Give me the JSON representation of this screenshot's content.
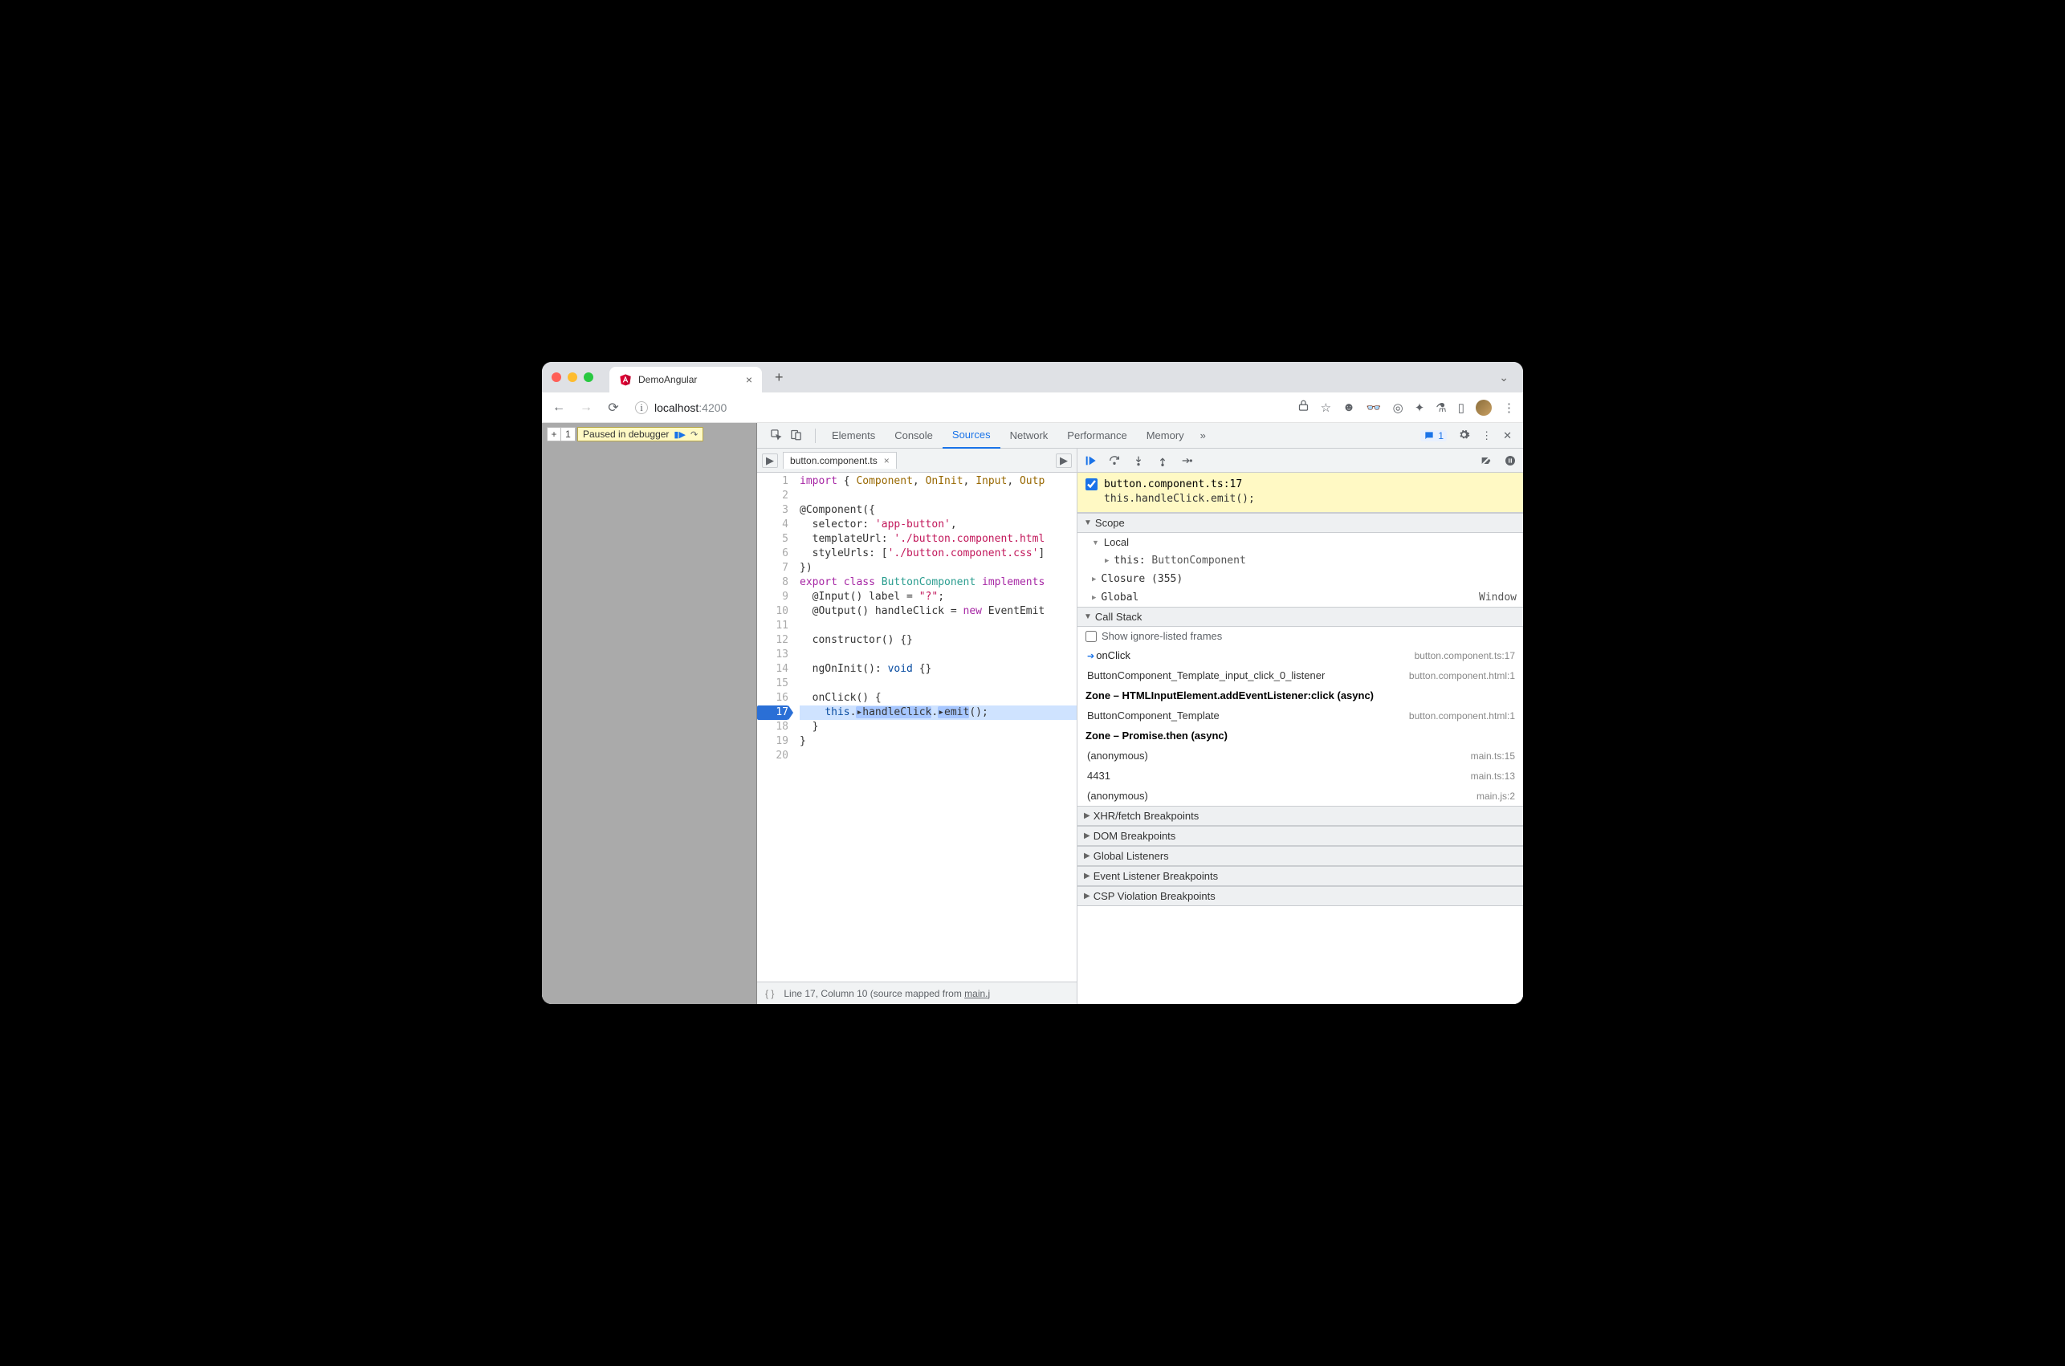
{
  "browser": {
    "tab_title": "DemoAngular",
    "url_host": "localhost",
    "url_port": ":4200"
  },
  "page": {
    "pause_label": "Paused in debugger"
  },
  "devtools": {
    "tabs": [
      "Elements",
      "Console",
      "Sources",
      "Network",
      "Performance",
      "Memory"
    ],
    "active_tab": "Sources",
    "issues_count": "1"
  },
  "editor": {
    "filename": "button.component.ts",
    "status": "Line 17, Column 10  (source mapped from ",
    "status_link": "main.j",
    "lines": [
      {
        "n": 1,
        "html": "<span class='k-purple'>import</span> { <span class='k-brown'>Component</span>, <span class='k-brown'>OnInit</span>, <span class='k-brown'>Input</span>, <span class='k-brown'>Outp</span>"
      },
      {
        "n": 2,
        "html": ""
      },
      {
        "n": 3,
        "html": "@Component({"
      },
      {
        "n": 4,
        "html": "  selector: <span class='k-red'>'app-button'</span>,"
      },
      {
        "n": 5,
        "html": "  templateUrl: <span class='k-red'>'./button.component.html</span>"
      },
      {
        "n": 6,
        "html": "  styleUrls: [<span class='k-red'>'./button.component.css'</span>]"
      },
      {
        "n": 7,
        "html": "})"
      },
      {
        "n": 8,
        "html": "<span class='k-purple'>export</span> <span class='k-purple'>class</span> <span class='k-green'>ButtonComponent</span> <span class='k-purple'>implements</span>"
      },
      {
        "n": 9,
        "html": "  @Input() label = <span class='k-red'>\"?\"</span>;"
      },
      {
        "n": 10,
        "html": "  @Output() handleClick = <span class='k-purple'>new</span> EventEmit"
      },
      {
        "n": 11,
        "html": ""
      },
      {
        "n": 12,
        "html": "  constructor() {}"
      },
      {
        "n": 13,
        "html": ""
      },
      {
        "n": 14,
        "html": "  ngOnInit(): <span class='k-blue'>void</span> {}"
      },
      {
        "n": 15,
        "html": ""
      },
      {
        "n": 16,
        "html": "  onClick() {"
      },
      {
        "n": 17,
        "html": "    <span class='k-blue'>this</span>.<span style='background:#a7c7ff;border-radius:2px'>▸handleClick</span>.<span style='background:#a7c7ff;border-radius:2px'>▸emit</span>();",
        "hl": true,
        "bp": true
      },
      {
        "n": 18,
        "html": "  }"
      },
      {
        "n": 19,
        "html": "}"
      },
      {
        "n": 20,
        "html": ""
      }
    ]
  },
  "breakpoint": {
    "file": "button.component.ts:17",
    "code": "this.handleClick.emit();"
  },
  "scope": {
    "title": "Scope",
    "local": "Local",
    "this_line": "this: ButtonComponent",
    "closure": "Closure (355)",
    "global": "Global",
    "global_val": "Window"
  },
  "callstack": {
    "title": "Call Stack",
    "ignore_label": "Show ignore-listed frames",
    "frames": [
      {
        "name": "onClick",
        "loc": "button.component.ts:17",
        "current": true
      },
      {
        "name": "ButtonComponent_Template_input_click_0_listener",
        "loc": "button.component.html:1"
      },
      {
        "zone": "Zone – HTMLInputElement.addEventListener:click (async)"
      },
      {
        "name": "ButtonComponent_Template",
        "loc": "button.component.html:1"
      },
      {
        "zone": "Zone – Promise.then (async)"
      },
      {
        "name": "(anonymous)",
        "loc": "main.ts:15"
      },
      {
        "name": "4431",
        "loc": "main.ts:13"
      },
      {
        "name": "(anonymous)",
        "loc": "main.js:2"
      }
    ]
  },
  "panels": {
    "xhr": "XHR/fetch Breakpoints",
    "dom": "DOM Breakpoints",
    "glob": "Global Listeners",
    "evt": "Event Listener Breakpoints",
    "csp": "CSP Violation Breakpoints"
  }
}
